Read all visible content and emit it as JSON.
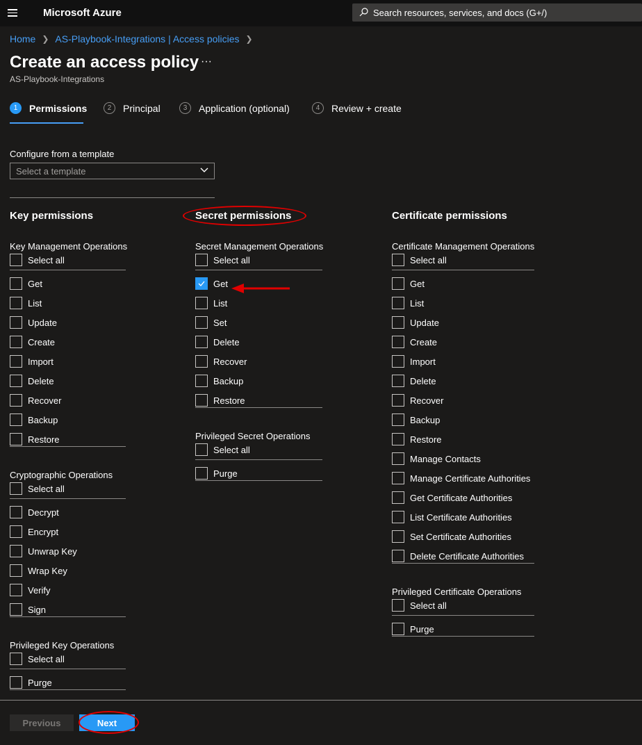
{
  "app": {
    "brand": "Microsoft Azure",
    "search_placeholder": "Search resources, services, and docs (G+/)",
    "icons": {
      "menu": "hamburger-icon",
      "search": "search-icon"
    }
  },
  "breadcrumb": [
    "Home",
    "AS-Playbook-Integrations | Access policies"
  ],
  "page": {
    "title": "Create an access policy",
    "ellipsis": "···",
    "subtitle": "AS-Playbook-Integrations"
  },
  "tabs": [
    {
      "num": "1",
      "label": "Permissions",
      "active": true
    },
    {
      "num": "2",
      "label": "Principal",
      "active": false
    },
    {
      "num": "3",
      "label": "Application (optional)",
      "active": false
    },
    {
      "num": "4",
      "label": "Review + create",
      "active": false
    }
  ],
  "template": {
    "label": "Configure from a template",
    "placeholder": "Select a template"
  },
  "key_permissions": {
    "title": "Key permissions",
    "management": {
      "title": "Key Management Operations",
      "select_all": "Select all",
      "items": [
        "Get",
        "List",
        "Update",
        "Create",
        "Import",
        "Delete",
        "Recover",
        "Backup",
        "Restore"
      ]
    },
    "crypto": {
      "title": "Cryptographic Operations",
      "select_all": "Select all",
      "items": [
        "Decrypt",
        "Encrypt",
        "Unwrap Key",
        "Wrap Key",
        "Verify",
        "Sign"
      ]
    },
    "privileged": {
      "title": "Privileged Key Operations",
      "select_all": "Select all",
      "items": [
        "Purge"
      ]
    }
  },
  "secret_permissions": {
    "title": "Secret permissions",
    "management": {
      "title": "Secret Management Operations",
      "select_all": "Select all",
      "items": [
        "Get",
        "List",
        "Set",
        "Delete",
        "Recover",
        "Backup",
        "Restore"
      ],
      "checked": [
        "Get"
      ]
    },
    "privileged": {
      "title": "Privileged Secret Operations",
      "select_all": "Select all",
      "items": [
        "Purge"
      ]
    }
  },
  "certificate_permissions": {
    "title": "Certificate permissions",
    "management": {
      "title": "Certificate Management Operations",
      "select_all": "Select all",
      "items": [
        "Get",
        "List",
        "Update",
        "Create",
        "Import",
        "Delete",
        "Recover",
        "Backup",
        "Restore",
        "Manage Contacts",
        "Manage Certificate Authorities",
        "Get Certificate Authorities",
        "List Certificate Authorities",
        "Set Certificate Authorities",
        "Delete Certificate Authorities"
      ]
    },
    "privileged": {
      "title": "Privileged Certificate Operations",
      "select_all": "Select all",
      "items": [
        "Purge"
      ]
    }
  },
  "footer": {
    "previous": "Previous",
    "next": "Next"
  },
  "colors": {
    "accent": "#2899f5",
    "link": "#479ef5",
    "annotation": "#e00000",
    "background": "#1b1a19"
  }
}
